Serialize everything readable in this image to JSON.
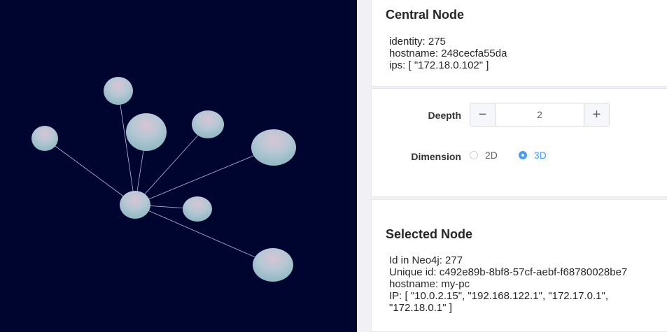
{
  "graph": {
    "edge_color": "#b8bce0",
    "node_color": "#a8c8d8",
    "background": "#000530"
  },
  "central_node": {
    "title": "Central Node",
    "properties": [
      "identity: 275",
      "hostname: 248cecfa55da",
      "ips: [ \"172.18.0.102\" ]"
    ]
  },
  "options": {
    "depth_label": "Deepth",
    "depth_value": "2",
    "minus_symbol": "−",
    "plus_symbol": "+",
    "dimension_label": "Dimension",
    "dimension_options": [
      "2D",
      "3D"
    ],
    "dimension_selected": "3D",
    "accent_color": "#409eff"
  },
  "selected_node": {
    "title": "Selected Node",
    "properties": [
      "Id in Neo4j: 277",
      "Unique id: c492e89b-8bf8-57cf-aebf-f68780028be7",
      "hostname: my-pc",
      "IP: [ \"10.0.2.15\", \"192.168.122.1\", \"172.17.0.1\",",
      "\"172.18.0.1\" ]"
    ]
  }
}
